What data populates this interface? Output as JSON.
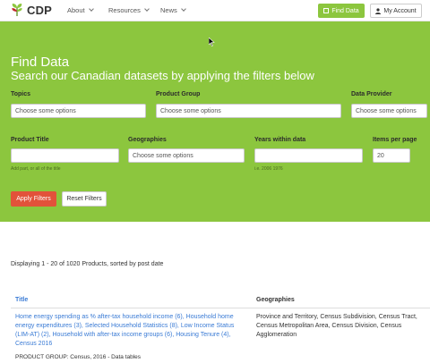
{
  "brand": {
    "name": "CDP",
    "accent": "#8cc63e"
  },
  "nav": {
    "items": [
      {
        "label": "About"
      },
      {
        "label": "Resources"
      },
      {
        "label": "News"
      }
    ],
    "find_data_label": "Find Data",
    "my_account_label": "My Account"
  },
  "hero": {
    "title": "Find Data",
    "subtitle": "Search our Canadian datasets by applying the filters below"
  },
  "filters": {
    "topics": {
      "label": "Topics",
      "placeholder": "Choose some options"
    },
    "product_group": {
      "label": "Product Group",
      "placeholder": "Choose some options"
    },
    "data_provider": {
      "label": "Data Provider",
      "placeholder": "Choose some options"
    },
    "product_title": {
      "label": "Product Title",
      "value": "",
      "hint": "Add part, or all of the title"
    },
    "geographies": {
      "label": "Geographies",
      "placeholder": "Choose some options"
    },
    "years": {
      "label": "Years within data",
      "value": "",
      "hint": "i.e. 2006 1976"
    },
    "items_per_page": {
      "label": "Items per page",
      "value": "20"
    },
    "apply_label": "Apply Filters",
    "reset_label": "Reset Filters"
  },
  "results": {
    "summary": "Displaying 1 - 20 of 1020 Products, sorted by post date",
    "columns": {
      "title": "Title",
      "geographies": "Geographies"
    },
    "rows": [
      {
        "title": "Home energy spending as % after-tax household income (6), Household home energy expenditures (3), Selected Household Statistics (8), Low Income Status (LIM-AT) (2), Household with after-tax income groups (6), Housing Tenure (4), Census 2016",
        "geographies": "Province and Territory, Census Subdivision, Census Tract, Census Metropolitan Area, Census Division, Census Agglomeration",
        "meta": "PRODUCT GROUP: Census, 2016 - Data tables"
      }
    ]
  }
}
